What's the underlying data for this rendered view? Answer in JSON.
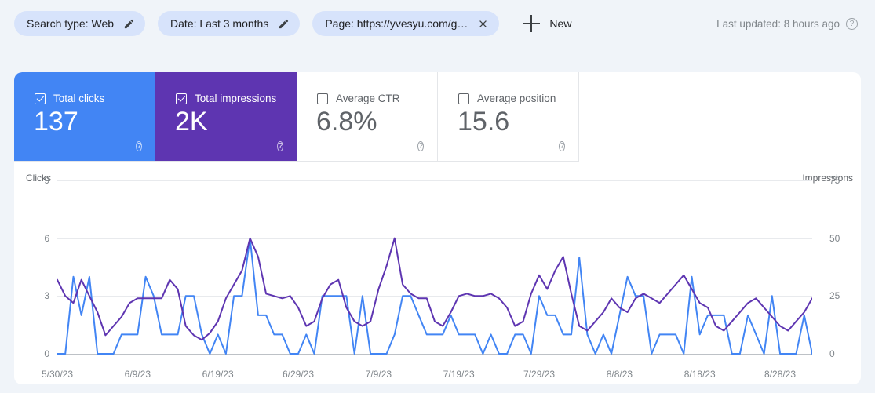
{
  "filters": {
    "chips": [
      {
        "label": "Search type: Web",
        "icon": "pencil-icon",
        "action": "edit"
      },
      {
        "label": "Date: Last 3 months",
        "icon": "pencil-icon",
        "action": "edit"
      },
      {
        "label": "Page: https://yvesyu.com/g…",
        "icon": "close-icon",
        "action": "remove"
      }
    ],
    "new_button": "New",
    "new_icon": "plus-icon",
    "last_updated": "Last updated: 8 hours ago",
    "last_updated_icon": "help-icon"
  },
  "metrics": [
    {
      "title": "Total clicks",
      "value": "137",
      "checked": true,
      "color": "#4285f4",
      "help_icon": "help-icon"
    },
    {
      "title": "Total impressions",
      "value": "2K",
      "checked": true,
      "color": "#5e35b1",
      "help_icon": "help-icon"
    },
    {
      "title": "Average CTR",
      "value": "6.8%",
      "checked": false,
      "color": "#ffffff",
      "help_icon": "help-icon"
    },
    {
      "title": "Average position",
      "value": "15.6",
      "checked": false,
      "color": "#ffffff",
      "help_icon": "help-icon"
    }
  ],
  "chart_data": {
    "type": "line",
    "title": "",
    "xlabel": "",
    "ylabel": "Clicks",
    "y2label": "Impressions",
    "grid": true,
    "legend": "none",
    "ylim": [
      0,
      9
    ],
    "y2lim": [
      0,
      75
    ],
    "yticks": [
      "0",
      "3",
      "6",
      "9"
    ],
    "y2ticks": [
      "0",
      "25",
      "50",
      "75"
    ],
    "xtick_labels": [
      "5/30/23",
      "6/9/23",
      "6/19/23",
      "6/29/23",
      "7/9/23",
      "7/19/23",
      "7/29/23",
      "8/8/23",
      "8/18/23",
      "8/28/23"
    ],
    "x_start": "5/30/23",
    "x_end": "9/1/23",
    "series": [
      {
        "name": "Clicks",
        "color": "#4285f4",
        "axis": "left",
        "values": [
          0,
          0,
          4,
          2,
          4,
          0,
          0,
          0,
          1,
          1,
          1,
          4,
          3,
          1,
          1,
          1,
          3,
          3,
          1,
          0,
          1,
          0,
          3,
          3,
          6,
          2,
          2,
          1,
          1,
          0,
          0,
          1,
          0,
          3,
          3,
          3,
          3,
          0,
          3,
          0,
          0,
          0,
          1,
          3,
          3,
          2,
          1,
          1,
          1,
          2,
          1,
          1,
          1,
          0,
          1,
          0,
          0,
          1,
          1,
          0,
          3,
          2,
          2,
          1,
          1,
          5,
          1,
          0,
          1,
          0,
          2,
          4,
          3,
          3,
          0,
          1,
          1,
          1,
          0,
          4,
          1,
          2,
          2,
          2,
          0,
          0,
          2,
          1,
          0,
          3,
          0,
          0,
          0,
          2,
          0
        ]
      },
      {
        "name": "Impressions",
        "color": "#5e35b1",
        "axis": "right",
        "values": [
          32,
          25,
          22,
          32,
          25,
          18,
          8,
          12,
          16,
          22,
          24,
          24,
          24,
          24,
          32,
          28,
          12,
          8,
          6,
          9,
          14,
          24,
          30,
          36,
          50,
          42,
          26,
          25,
          24,
          25,
          20,
          12,
          14,
          24,
          30,
          32,
          20,
          14,
          12,
          14,
          28,
          38,
          50,
          30,
          26,
          24,
          24,
          14,
          12,
          18,
          25,
          26,
          25,
          25,
          26,
          24,
          20,
          12,
          14,
          26,
          34,
          28,
          36,
          42,
          26,
          12,
          10,
          14,
          18,
          24,
          20,
          18,
          24,
          26,
          24,
          22,
          26,
          30,
          34,
          28,
          22,
          20,
          12,
          10,
          14,
          18,
          22,
          24,
          20,
          16,
          12,
          10,
          14,
          18,
          24
        ]
      }
    ]
  }
}
